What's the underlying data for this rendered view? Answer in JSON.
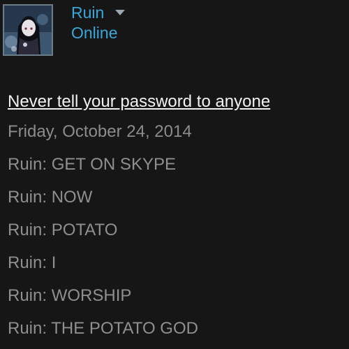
{
  "profile": {
    "name": "Ruin",
    "status": "Online"
  },
  "chat": {
    "warning": "Never tell your password to anyone",
    "date": "Friday, October 24, 2014",
    "messages": [
      {
        "text": "Ruin: GET ON SKYPE"
      },
      {
        "text": "Ruin: NOW"
      },
      {
        "text": "Ruin: POTATO"
      },
      {
        "text": "Ruin: I"
      },
      {
        "text": "Ruin: WORSHIP"
      },
      {
        "text": "Ruin: THE POTATO GOD"
      }
    ]
  },
  "colors": {
    "background": "#161616",
    "accent": "#3aa7d8",
    "message_text": "#8f8f8f",
    "warning_text": "#f2f2f2"
  },
  "icons": {
    "menu": "chevron-down-icon"
  }
}
